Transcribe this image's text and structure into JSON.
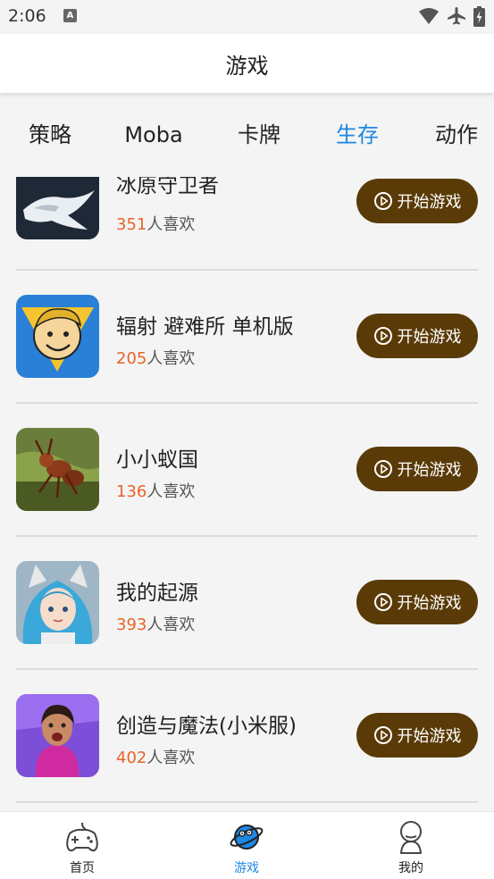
{
  "status": {
    "time": "2:06",
    "notif_letter": "A"
  },
  "header": {
    "title": "游戏"
  },
  "tabs": [
    {
      "label": "策略",
      "active": false
    },
    {
      "label": "Moba",
      "active": false
    },
    {
      "label": "卡牌",
      "active": false
    },
    {
      "label": "生存",
      "active": true
    },
    {
      "label": "动作",
      "active": false
    }
  ],
  "games": [
    {
      "title": "冰原守卫者",
      "likes": "351",
      "likes_suffix": "人喜欢",
      "button": "开始游戏"
    },
    {
      "title": "辐射 避难所 单机版",
      "likes": "205",
      "likes_suffix": "人喜欢",
      "button": "开始游戏"
    },
    {
      "title": "小小蚁国",
      "likes": "136",
      "likes_suffix": "人喜欢",
      "button": "开始游戏"
    },
    {
      "title": "我的起源",
      "likes": "393",
      "likes_suffix": "人喜欢",
      "button": "开始游戏"
    },
    {
      "title": "创造与魔法(小米服)",
      "likes": "402",
      "likes_suffix": "人喜欢",
      "button": "开始游戏"
    }
  ],
  "bottom_nav": [
    {
      "label": "首页",
      "icon": "gamepad-icon",
      "active": false
    },
    {
      "label": "游戏",
      "icon": "planet-icon",
      "active": true
    },
    {
      "label": "我的",
      "icon": "user-icon",
      "active": false
    }
  ],
  "colors": {
    "accent": "#1e88e5",
    "button": "#5a3b08",
    "likes_number": "#e8632b"
  }
}
